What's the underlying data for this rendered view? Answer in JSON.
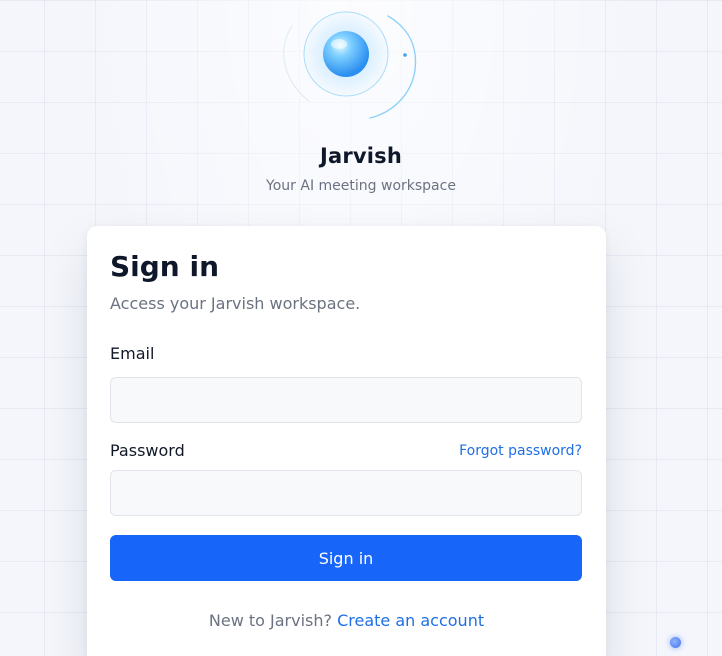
{
  "brand": {
    "name": "Jarvish",
    "tagline": "Your AI meeting workspace",
    "logo_icon": "orb-orbit-icon"
  },
  "signin": {
    "title": "Sign in",
    "subtitle": "Access your Jarvish workspace.",
    "email_label": "Email",
    "email_value": "",
    "email_placeholder": "",
    "password_label": "Password",
    "password_value": "",
    "password_placeholder": "",
    "forgot_label": "Forgot password?",
    "submit_label": "Sign in",
    "signup_prompt": "New to Jarvish?",
    "signup_link": "Create an account"
  },
  "colors": {
    "accent": "#1765f9",
    "link": "#1f6fe5",
    "title": "#0f172a",
    "muted": "#6b7280"
  }
}
